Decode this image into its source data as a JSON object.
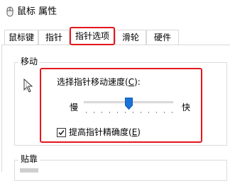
{
  "window": {
    "title": "鼠标 属性",
    "icon": "mouse-icon"
  },
  "tabs": [
    {
      "label": "鼠标键",
      "selected": false
    },
    {
      "label": "指针",
      "selected": false
    },
    {
      "label": "指针选项",
      "selected": true
    },
    {
      "label": "滑轮",
      "selected": false
    },
    {
      "label": "硬件",
      "selected": false
    }
  ],
  "motion": {
    "group_label": "移动",
    "speed_label_prefix": "选择指针移动速度(",
    "speed_label_accel": "C",
    "speed_label_suffix": "):",
    "slow_label": "慢",
    "fast_label": "快",
    "speed_value": 0.5,
    "precision_checked": true,
    "precision_label_prefix": "提高指针精确度(",
    "precision_label_accel": "E",
    "precision_label_suffix": ")"
  },
  "snap": {
    "group_label": "贴靠"
  },
  "colors": {
    "highlight": "#e5161c",
    "slider_thumb": "#1a73d9"
  }
}
